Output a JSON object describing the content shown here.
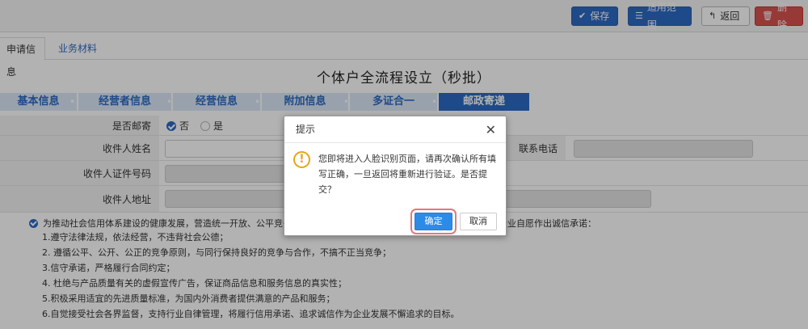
{
  "toolbar": {
    "save_label": "保存",
    "scope_label": "适用范围",
    "back_label": "返回",
    "delete_label": "删除"
  },
  "tabs": [
    {
      "label": "申请信息",
      "active": true
    },
    {
      "label": "业务材料",
      "active": false
    }
  ],
  "page_title": "个体户全流程设立（秒批）",
  "steps": [
    "基本信息",
    "经营者信息",
    "经营信息",
    "附加信息",
    "多证合一",
    "邮政寄递"
  ],
  "form": {
    "mail_label": "是否邮寄",
    "mail_options": [
      "否",
      "是"
    ],
    "mail_selected": "否",
    "recipient_name_label": "收件人姓名",
    "phone_label": "联系电话",
    "id_label": "收件人证件号码",
    "address_label": "收件人地址"
  },
  "promise": {
    "head_left": "为推动社会信用体系建设的健康发展，营造统一开放、公平竞争",
    "head_right": "企业自愿作出诚信承诺：",
    "items": [
      "1.遵守法律法规，依法经营，不违背社会公德；",
      "2. 遵循公平、公开、公正的竞争原则，与同行保持良好的竞争与合作，不搞不正当竞争；",
      "3.信守承诺，严格履行合同约定；",
      "4. 杜绝与产品质量有关的虚假宣传广告，保证商品信息和服务信息的真实性；",
      "5.积极采用适宜的先进质量标准，为国内外消费者提供满意的产品和服务；",
      "6.自觉接受社会各界监督，支持行业自律管理，将履行信用承诺、追求诚信作为企业发展不懈追求的目标。"
    ]
  },
  "dialog": {
    "title": "提示",
    "message": "您即将进入人脸识别页面，请再次确认所有填写正确，一旦返回将重新进行验证。是否提交？",
    "ok_label": "确定",
    "cancel_label": "取消"
  },
  "colors": {
    "primary": "#2d6bc4",
    "danger": "#d9534f",
    "warning": "#e8a317",
    "highlight": "#e07a7a"
  }
}
